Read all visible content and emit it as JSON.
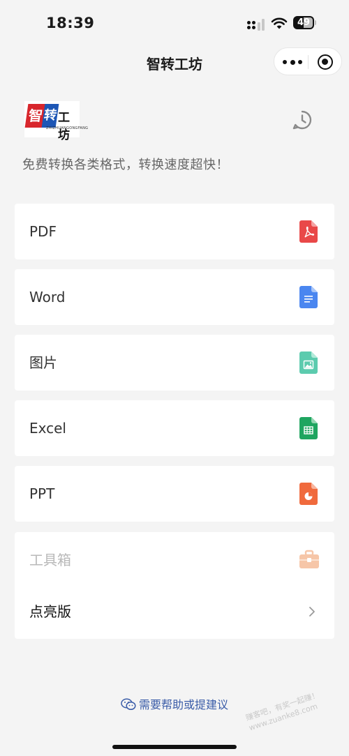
{
  "status_bar": {
    "time": "18:39",
    "battery": "49"
  },
  "nav": {
    "title": "智转工坊"
  },
  "header": {
    "logo_text": "智转工坊",
    "logo_subtext": "ZHIZHUANGONGFANG",
    "tagline": "免费转换各类格式，转换速度超快！"
  },
  "menu": [
    {
      "label": "PDF",
      "icon": "pdf-file-icon",
      "color": "#e94848"
    },
    {
      "label": "Word",
      "icon": "word-file-icon",
      "color": "#4a86f0"
    },
    {
      "label": "图片",
      "icon": "image-file-icon",
      "color": "#5ccbae"
    },
    {
      "label": "Excel",
      "icon": "excel-file-icon",
      "color": "#1fa560"
    },
    {
      "label": "PPT",
      "icon": "ppt-file-icon",
      "color": "#f06a3d"
    }
  ],
  "toolbox": {
    "label": "工具箱",
    "icon_color": "#f6c6a8",
    "item_label": "点亮版"
  },
  "footer": {
    "help_text": "需要帮助或提建议",
    "watermark_line1": "赚客吧，有奖一起赚！",
    "watermark_line2": "www.zuanke8.com"
  }
}
